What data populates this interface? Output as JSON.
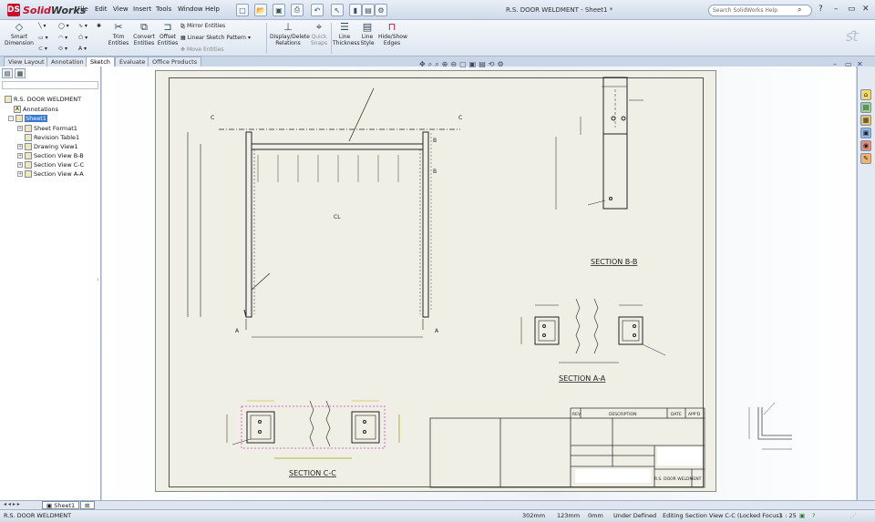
{
  "app": {
    "brand_prefix": "Solid",
    "brand_suffix": "Works",
    "document_title": "R.S. DOOR WELDMENT - Sheet1 *",
    "search_placeholder": "Search SolidWorks Help"
  },
  "menu": [
    "File",
    "Edit",
    "View",
    "Insert",
    "Tools",
    "Window",
    "Help"
  ],
  "commands": {
    "smart_dimension": "Smart Dimension",
    "trim": "Trim Entities",
    "convert": "Convert Entities",
    "offset": "Offset Entities",
    "mirror": "Mirror Entities",
    "linear_pattern": "Linear Sketch Pattern",
    "move": "Move Entities",
    "display_delete": "Display/Delete Relations",
    "quick_snaps": "Quick Snaps",
    "line_thickness": "Line Thickness",
    "line_style": "Line Style",
    "hide_show": "Hide/Show Edges"
  },
  "tabs": [
    "View Layout",
    "Annotation",
    "Sketch",
    "Evaluate",
    "Office Products"
  ],
  "active_tab": "Sketch",
  "tree": {
    "root": "R.S. DOOR WELDMENT",
    "items": [
      {
        "label": "Annotations"
      },
      {
        "label": "Sheet1"
      },
      {
        "label": "Sheet Format1"
      },
      {
        "label": "Revision Table1"
      },
      {
        "label": "Drawing View1"
      },
      {
        "label": "Section View B-B"
      },
      {
        "label": "Section View C-C"
      },
      {
        "label": "Section View A-A"
      }
    ]
  },
  "drawing": {
    "section_bb": "SECTION B-B",
    "section_aa": "SECTION A-A",
    "section_cc": "SECTION C-C",
    "cut_a": "A",
    "cut_b": "B",
    "cut_c": "C",
    "center_mark": "CL",
    "title_block": {
      "rev": "REV",
      "description": "DESCRIPTION",
      "date": "DATE",
      "approved": "APP'D",
      "door_label": "R.S. DOOR WELDMENT"
    }
  },
  "sheet_tab": "Sheet1",
  "status": {
    "doc": "R.S. DOOR WELDMENT",
    "x": "302mm",
    "y": "123mm",
    "z": "0mm",
    "state": "Under Defined",
    "editing": "Editing Section View C-C (Locked Focus)",
    "scale": "1 : 25"
  }
}
